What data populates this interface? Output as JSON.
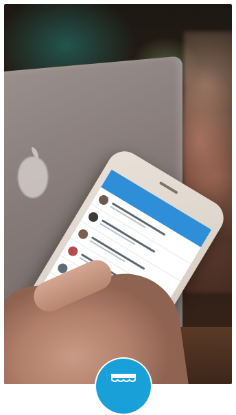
{
  "scene": {
    "description_free": true
  },
  "phone_app": {
    "header_left": "",
    "header_title": "",
    "header_right": "",
    "messages": [
      {
        "avatar_color": "#6b5a52"
      },
      {
        "avatar_color": "#3e3b3a"
      },
      {
        "avatar_color": "#7a5e4e"
      },
      {
        "avatar_color": "#b44a4a"
      },
      {
        "avatar_color": "#5f6b74"
      },
      {
        "avatar_color": "#8a7a6e"
      }
    ]
  },
  "badge": {
    "icon": "storefront-awning-icon",
    "color": "#1aa0d8"
  }
}
